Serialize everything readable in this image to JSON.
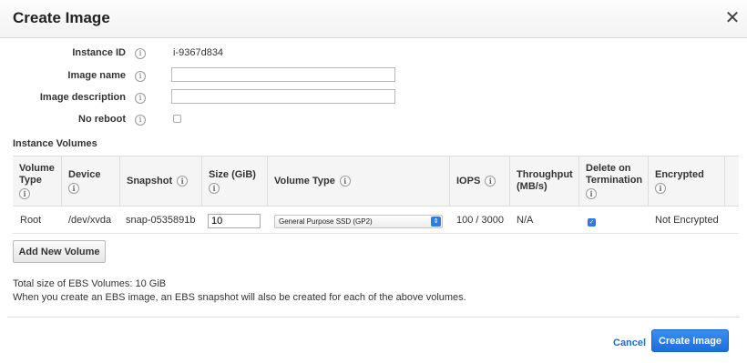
{
  "dialog": {
    "title": "Create Image",
    "close_symbol": "✕"
  },
  "form": {
    "instance_id": {
      "label": "Instance ID",
      "value": "i-9367d834"
    },
    "image_name": {
      "label": "Image name",
      "value": ""
    },
    "image_description": {
      "label": "Image description",
      "value": ""
    },
    "no_reboot": {
      "label": "No reboot",
      "checked": false
    }
  },
  "volumes": {
    "section_title": "Instance Volumes",
    "columns": {
      "volume_type_l1": "Volume",
      "volume_type_l2": "Type",
      "device": "Device",
      "snapshot": "Snapshot",
      "size": "Size (GiB)",
      "volume_type2": "Volume Type",
      "iops": "IOPS",
      "throughput_l1": "Throughput",
      "throughput_l2": "(MB/s)",
      "delete_l1": "Delete on",
      "delete_l2": "Termination",
      "encrypted": "Encrypted"
    },
    "rows": [
      {
        "volume_type": "Root",
        "device": "/dev/xvda",
        "snapshot": "snap-0535891b",
        "size": "10",
        "volume_type2": "General Purpose SSD (GP2)",
        "iops": "100 / 3000",
        "throughput": "N/A",
        "delete_on_termination": true,
        "encrypted": "Not Encrypted"
      }
    ],
    "add_button": "Add New Volume"
  },
  "footer": {
    "total_size": "Total size of EBS Volumes: 10 GiB",
    "note": "When you create an EBS image, an EBS snapshot will also be created for each of the above volumes.",
    "cancel": "Cancel",
    "create": "Create Image"
  },
  "icons": {
    "info": "i",
    "check": "✓",
    "select_arrows": "⇕"
  },
  "colors": {
    "primary": "#2b7de0",
    "link": "#1f6bcc",
    "header_bg": "#f2f2f2"
  }
}
